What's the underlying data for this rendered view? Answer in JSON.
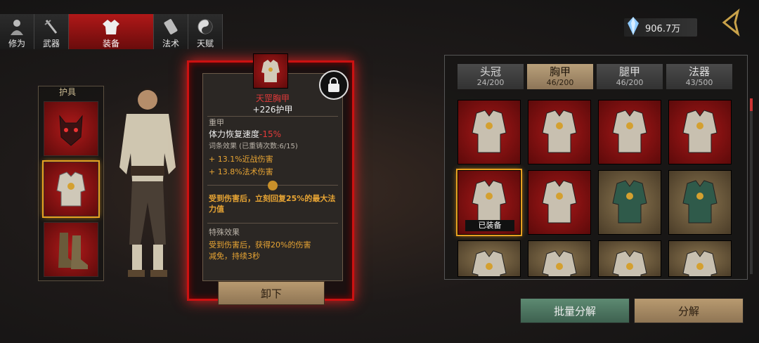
{
  "top_tabs": [
    {
      "label": "修为",
      "icon": "bust-icon"
    },
    {
      "label": "武器",
      "icon": "sword-icon"
    },
    {
      "label": "装备",
      "icon": "robe-icon",
      "active": true
    },
    {
      "label": "法术",
      "icon": "scroll-icon"
    },
    {
      "label": "天赋",
      "icon": "yinyang-icon"
    }
  ],
  "currency": {
    "value": "906.7万",
    "icon": "crystal-icon"
  },
  "gear_panel": {
    "label": "护具"
  },
  "item_card": {
    "name": "天罡胸甲",
    "main_stat": "+226护甲",
    "type": "重甲",
    "line1_prefix": "体力恢复速度",
    "line1_value": "-15%",
    "affix_header": "词条效果 (已重铸次数:6/15)",
    "affix1": "+ 13.1%近战伤害",
    "affix2": "+ 13.8%法术伤害",
    "set_bonus": "受到伤害后，立刻回复25%的最大法力值",
    "special_header": "特殊效果",
    "special_text_l1": "受到伤害后，获得20%的伤害",
    "special_text_l2": "减免，持续3秒",
    "unequip_label": "卸下"
  },
  "category_tabs": [
    {
      "name": "头冠",
      "count": "24/200"
    },
    {
      "name": "胸甲",
      "count": "46/200",
      "active": true
    },
    {
      "name": "腿甲",
      "count": "46/200"
    },
    {
      "name": "法器",
      "count": "43/500"
    }
  ],
  "inventory": {
    "equipped_label": "已装备",
    "rows": [
      [
        "red",
        "red",
        "red",
        "red"
      ],
      [
        "red",
        "red",
        "tan",
        "tan"
      ],
      [
        "tan",
        "tan",
        "tan",
        "tan"
      ]
    ]
  },
  "buttons": {
    "batch_decompose": "批量分解",
    "decompose": "分解"
  },
  "colors": {
    "accent_red": "#b01818",
    "gold": "#e8a534",
    "stat_red": "#e23a3a"
  }
}
